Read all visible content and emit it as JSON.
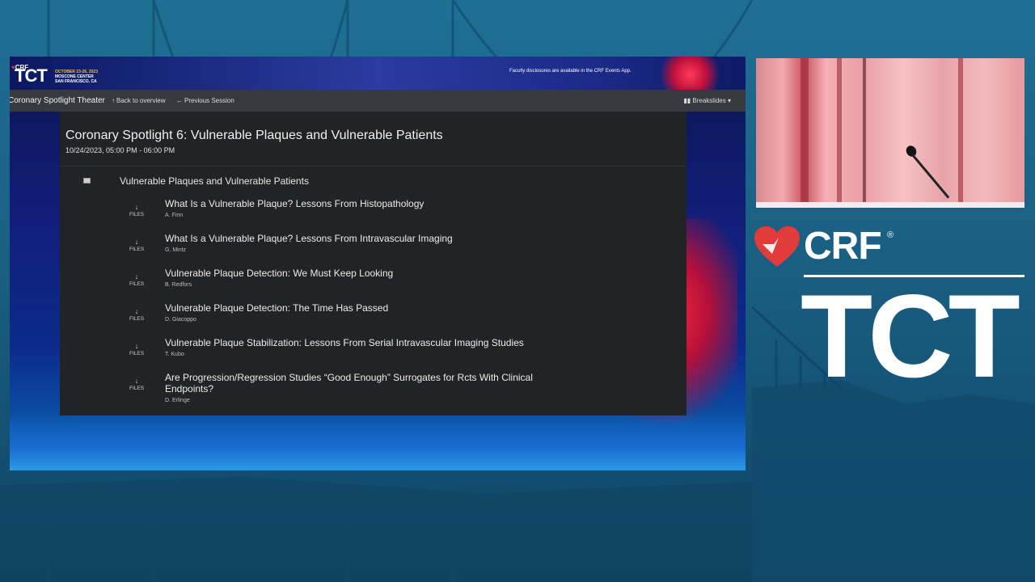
{
  "header": {
    "crf_mark": "CRF",
    "tct_mark": "TCT",
    "event_date": "OCTOBER 23-26, 2023",
    "event_venue": "MOSCONE CENTER",
    "event_city": "SAN FRANCISCO, CA",
    "disclosure": "Faculty disclosures are available in the CRF Events App."
  },
  "navbar": {
    "theater": "Coronary Spotlight Theater",
    "back_icon": "arrow-up-icon",
    "back_label": "Back to overview",
    "prev_icon": "arrow-left-icon",
    "prev_label": "Previous Session",
    "breakslides_icon": "columns-icon",
    "breakslides_label": "Breakslides"
  },
  "session": {
    "title": "Coronary Spotlight 6: Vulnerable Plaques and Vulnerable Patients",
    "time": "10/24/2023, 05:00 PM - 06:00 PM",
    "group_title": "Vulnerable Plaques and Vulnerable Patients",
    "files_label": "FILES",
    "talks": [
      {
        "title": "What Is a Vulnerable Plaque? Lessons From Histopathology",
        "speaker": "A. Finn"
      },
      {
        "title": "What Is a Vulnerable Plaque? Lessons From Intravascular Imaging",
        "speaker": "G. Mintz"
      },
      {
        "title": "Vulnerable Plaque Detection: We Must Keep Looking",
        "speaker": "B. Redfors"
      },
      {
        "title": "Vulnerable Plaque Detection: The Time Has Passed",
        "speaker": "D. Giacoppo"
      },
      {
        "title": "Vulnerable Plaque Stabilization: Lessons From Serial Intravascular Imaging Studies",
        "speaker": "T. Kubo"
      },
      {
        "title": "Are Progression/Regression Studies “Good Enough” Surrogates for Rcts With Clinical Endpoints?",
        "speaker": "D. Erlinge"
      }
    ]
  },
  "branding": {
    "crf": "CRF",
    "registered": "®",
    "tct": "TCT"
  },
  "colors": {
    "background": "#1a5f82",
    "panel": "#212325",
    "navbar": "#363a3e",
    "brand_red": "#e23b3b"
  }
}
